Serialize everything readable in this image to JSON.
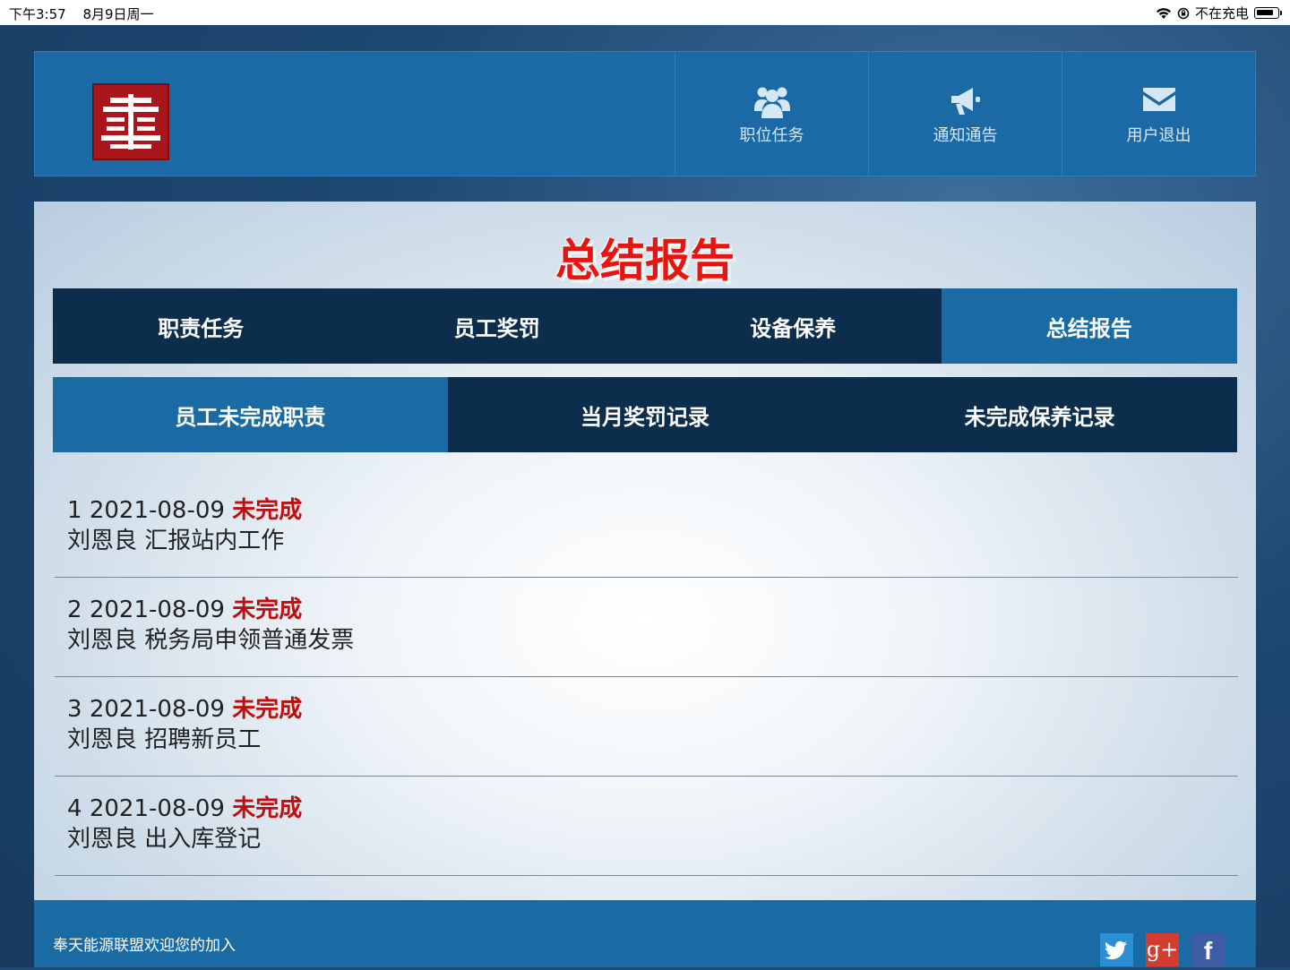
{
  "status_bar": {
    "time": "下午3:57",
    "date": "8月9日周一",
    "charging": "不在充电"
  },
  "header": {
    "nav": [
      {
        "label": "职位任务",
        "icon": "users-icon"
      },
      {
        "label": "通知通告",
        "icon": "megaphone-icon"
      },
      {
        "label": "用户退出",
        "icon": "envelope-icon"
      }
    ]
  },
  "main": {
    "title": "总结报告",
    "tabs": [
      {
        "label": "职责任务",
        "active": false
      },
      {
        "label": "员工奖罚",
        "active": false
      },
      {
        "label": "设备保养",
        "active": false
      },
      {
        "label": "总结报告",
        "active": true
      }
    ],
    "subtabs": [
      {
        "label": "员工未完成职责",
        "active": true
      },
      {
        "label": "当月奖罚记录",
        "active": false
      },
      {
        "label": "未完成保养记录",
        "active": false
      }
    ],
    "rows": [
      {
        "index": "1",
        "date": "2021-08-09",
        "status": "未完成",
        "detail": "刘恩良 汇报站内工作"
      },
      {
        "index": "2",
        "date": "2021-08-09",
        "status": "未完成",
        "detail": "刘恩良 税务局申领普通发票"
      },
      {
        "index": "3",
        "date": "2021-08-09",
        "status": "未完成",
        "detail": "刘恩良 招聘新员工"
      },
      {
        "index": "4",
        "date": "2021-08-09",
        "status": "未完成",
        "detail": "刘恩良 出入库登记"
      }
    ]
  },
  "footer": {
    "text": "奉天能源联盟欢迎您的加入",
    "social": [
      "twitter-icon",
      "google-plus-icon",
      "facebook-icon"
    ],
    "gplus_glyph": "g+",
    "fb_glyph": "f"
  },
  "colors": {
    "accent": "#1a6aa3",
    "dark_tab": "#0c2d4b",
    "title_red": "#e8140f",
    "status_red": "#c00d0d"
  }
}
